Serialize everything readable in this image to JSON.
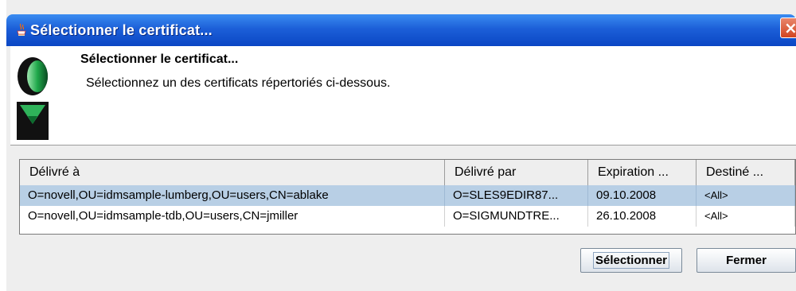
{
  "window": {
    "title": "Sélectionner le certificat...",
    "close_glyph": "×"
  },
  "header": {
    "title": "Sélectionner le certificat...",
    "description": "Sélectionnez un des certificats répertoriés ci-dessous."
  },
  "icons": {
    "app": "java-coffee-icon",
    "logo": "novell-identity-logo",
    "close": "close-icon"
  },
  "table": {
    "columns": [
      "Délivré à",
      "Délivré par",
      "Expiration ...",
      "Destiné ..."
    ],
    "rows": [
      [
        "O=novell,OU=idmsample-lumberg,OU=users,CN=ablake",
        "O=SLES9EDIR87...",
        "09.10.2008",
        "<All>"
      ],
      [
        "O=novell,OU=idmsample-tdb,OU=users,CN=jmiller",
        "O=SIGMUNDTRE...",
        "26.10.2008",
        "<All>"
      ]
    ],
    "selected_row": 0
  },
  "buttons": {
    "select": "Sélectionner",
    "close": "Fermer"
  },
  "colors": {
    "titlebar": "#0a46c4",
    "selection": "#b8cfe5",
    "close_button": "#d2441f"
  }
}
